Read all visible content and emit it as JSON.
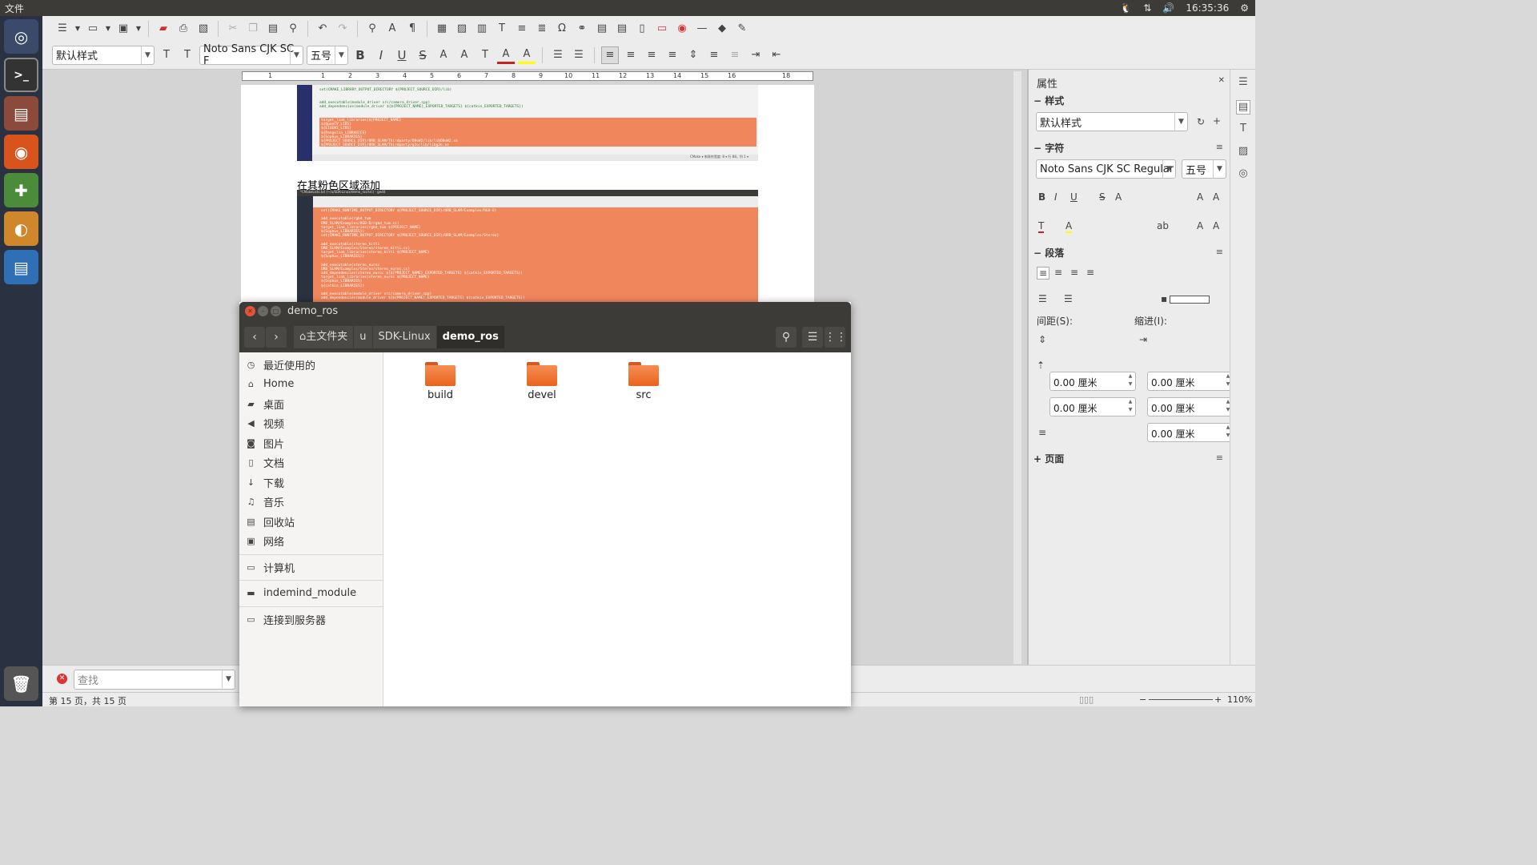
{
  "topbar": {
    "app_menu": "文件",
    "time": "16:35:36"
  },
  "writer": {
    "para_style": "默认样式",
    "font_name": "Noto Sans CJK SC F",
    "font_size": "五号",
    "ruler_numbers": [
      "1",
      "1",
      "2",
      "3",
      "4",
      "5",
      "6",
      "7",
      "8",
      "9",
      "10",
      "11",
      "12",
      "13",
      "14",
      "15",
      "16",
      "18"
    ],
    "doc_heading": "在其粉色区域添加",
    "find_placeholder": "查找",
    "status_page": "第 15 页，共 15 页",
    "zoom": "110%"
  },
  "sidebar": {
    "title": "属性",
    "styles_section": "样式",
    "styles_value": "默认样式",
    "char_section": "字符",
    "char_font": "Noto Sans CJK SC Regular",
    "char_size": "五号",
    "para_section": "段落",
    "spacing_label": "间距(S):",
    "indent_label": "缩进(I):",
    "values": [
      "0.00 厘米",
      "0.00 厘米",
      "0.00 厘米",
      "0.00 厘米",
      "0.00 厘米"
    ],
    "page_section": "页面"
  },
  "files": {
    "title": "demo_ros",
    "breadcrumbs": [
      "主文件夹",
      "u",
      "SDK-Linux",
      "demo_ros"
    ],
    "places": [
      {
        "icon": "clock-icon",
        "glyph": "◷",
        "label": "最近使用的"
      },
      {
        "icon": "home-icon",
        "glyph": "⌂",
        "label": "Home"
      },
      {
        "icon": "folder-icon",
        "glyph": "▰",
        "label": "桌面"
      },
      {
        "icon": "video-icon",
        "glyph": "◀",
        "label": "视频"
      },
      {
        "icon": "camera-icon",
        "glyph": "◙",
        "label": "图片"
      },
      {
        "icon": "document-icon",
        "glyph": "▯",
        "label": "文档"
      },
      {
        "icon": "download-icon",
        "glyph": "↓",
        "label": "下载"
      },
      {
        "icon": "music-icon",
        "glyph": "♫",
        "label": "音乐"
      },
      {
        "icon": "trash-icon",
        "glyph": "▤",
        "label": "回收站"
      },
      {
        "icon": "network-icon",
        "glyph": "▣",
        "label": "网络"
      }
    ],
    "computer": "计算机",
    "device": "indemind_module",
    "connect": "连接到服务器",
    "folders": [
      "build",
      "devel",
      "src"
    ]
  }
}
